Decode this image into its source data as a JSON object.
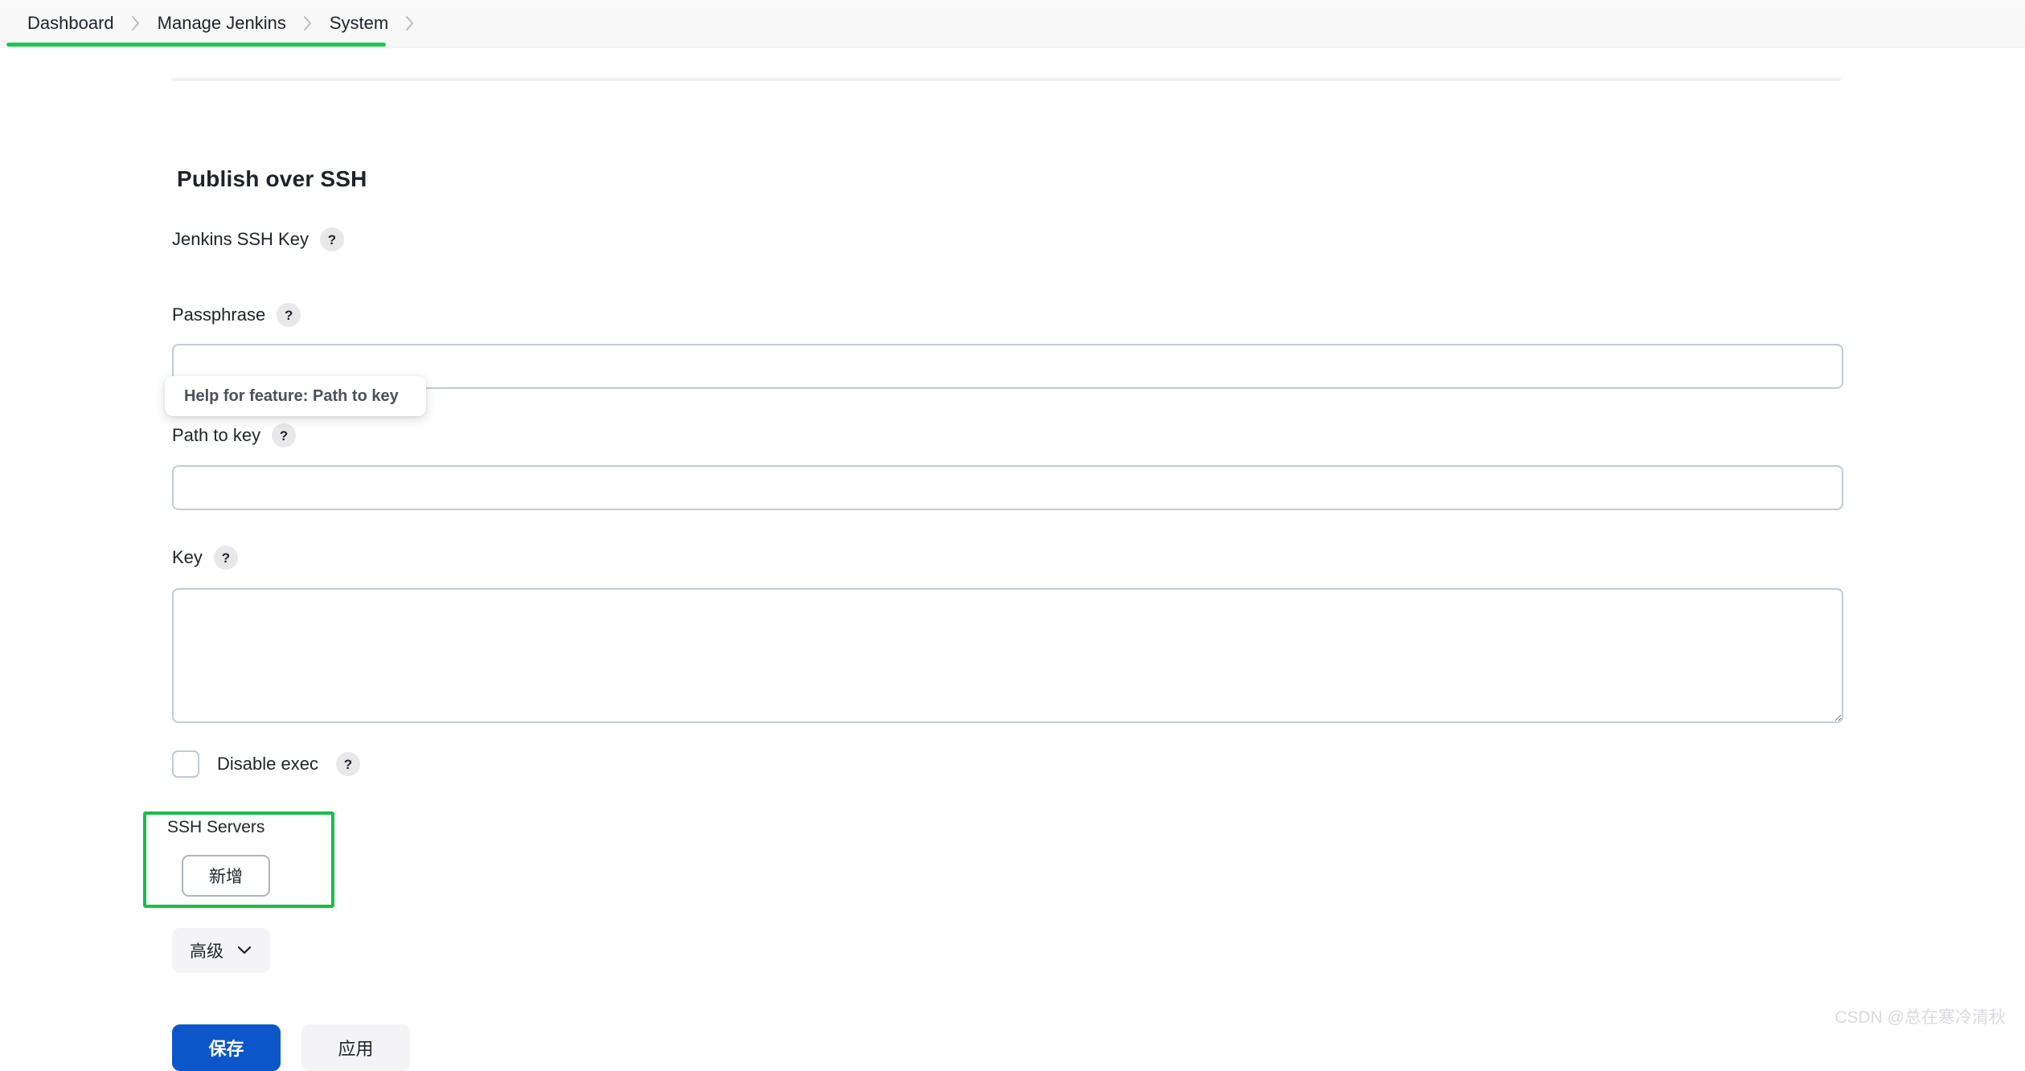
{
  "breadcrumb": {
    "items": [
      {
        "label": "Dashboard"
      },
      {
        "label": "Manage Jenkins"
      },
      {
        "label": "System"
      }
    ],
    "separator_icon": "chevron-right-icon",
    "underline_color": "#23c552"
  },
  "section": {
    "title": "Publish over SSH"
  },
  "fields": {
    "jenkins_ssh_key": {
      "label": "Jenkins SSH Key",
      "help_icon": "help-question-icon",
      "help_label": "?"
    },
    "passphrase": {
      "label": "Passphrase",
      "help_icon": "help-question-icon",
      "help_label": "?",
      "value": "",
      "placeholder": ""
    },
    "path_to_key": {
      "label": "Path to key",
      "help_icon": "help-question-icon",
      "help_label": "?",
      "value": "",
      "placeholder": ""
    },
    "key": {
      "label": "Key",
      "help_icon": "help-question-icon",
      "help_label": "?",
      "value": "",
      "placeholder": ""
    },
    "disable_exec": {
      "label": "Disable exec",
      "help_icon": "help-question-icon",
      "help_label": "?",
      "checked": false
    }
  },
  "tooltip": {
    "text": "Help for feature: Path to key"
  },
  "ssh_servers": {
    "label": "SSH Servers",
    "add_button_label": "新增",
    "highlight_color": "#19bd4a"
  },
  "advanced": {
    "label": "高级",
    "chevron_icon": "chevron-down-icon"
  },
  "footer": {
    "save_label": "保存",
    "apply_label": "应用",
    "save_color": "#0b57c9"
  },
  "watermark": {
    "text": "CSDN @总在寒冷清秋"
  }
}
